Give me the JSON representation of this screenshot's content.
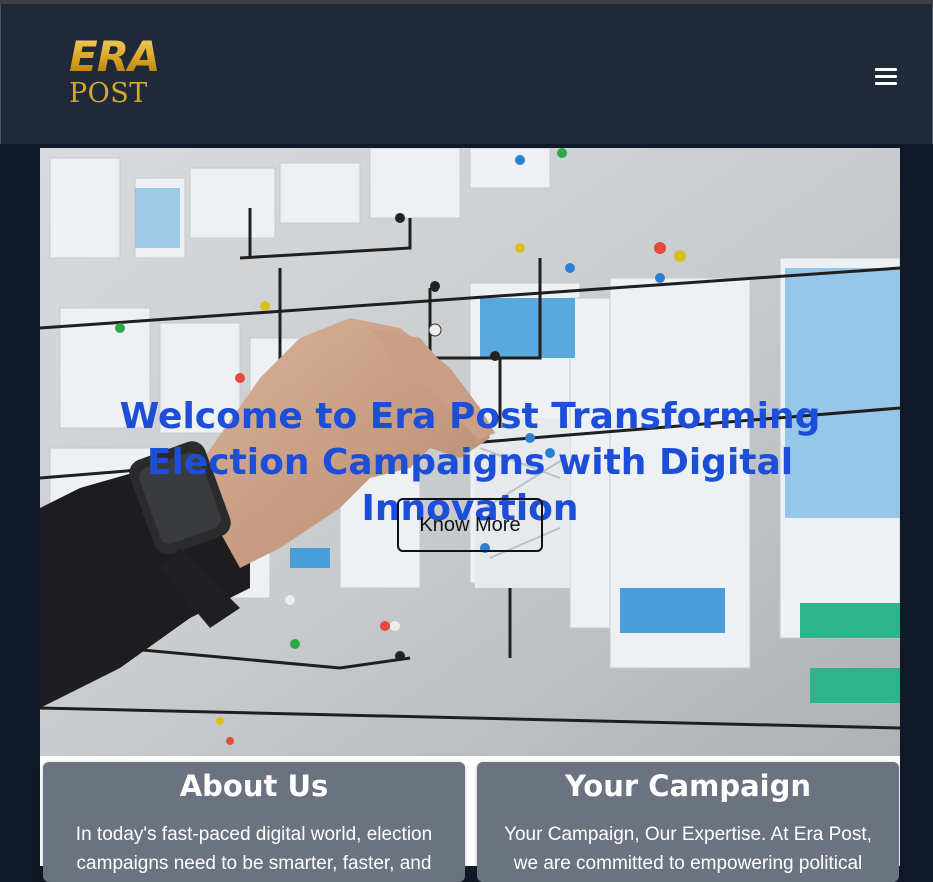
{
  "brand": {
    "logo_top": "ERA",
    "logo_bottom": "POST"
  },
  "nav": {
    "menu_icon": "hamburger-menu-icon"
  },
  "hero": {
    "title": "Welcome to Era Post Transforming Election Campaigns with Digital Innovation",
    "button_label": "Know More"
  },
  "cards": [
    {
      "title": "About Us",
      "text": "In today's fast-paced digital world, election campaigns need to be smarter, faster, and"
    },
    {
      "title": "Your Campaign",
      "text": "Your Campaign, Our Expertise. At Era Post, we are committed to empowering political"
    }
  ],
  "colors": {
    "nav_bg": "#1f2937",
    "page_bg": "#111827",
    "hero_title": "#1d4ed8",
    "card_bg": "#6b7280",
    "logo_gold": "#e7b634"
  }
}
